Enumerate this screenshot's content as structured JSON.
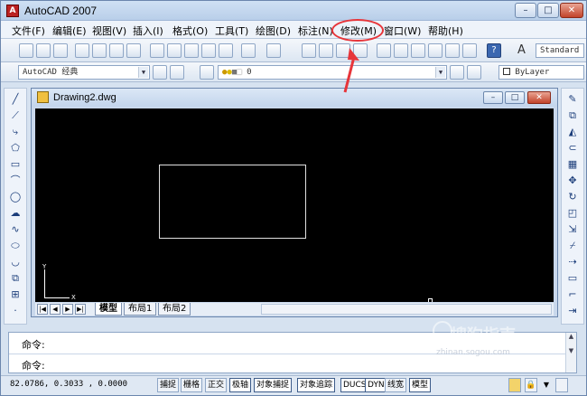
{
  "app": {
    "title": "AutoCAD 2007"
  },
  "window_buttons": {
    "minimize": "–",
    "maximize": "□",
    "close": "✕"
  },
  "menu": [
    {
      "label": "文件(F)"
    },
    {
      "label": "编辑(E)"
    },
    {
      "label": "视图(V)"
    },
    {
      "label": "插入(I)"
    },
    {
      "label": "格式(O)"
    },
    {
      "label": "工具(T)"
    },
    {
      "label": "绘图(D)"
    },
    {
      "label": "标注(N)"
    },
    {
      "label": "修改(M)"
    },
    {
      "label": "窗口(W)"
    },
    {
      "label": "帮助(H)"
    }
  ],
  "toolbar": {
    "text_style": "Standard",
    "workspace": "AutoCAD 经典",
    "layer": "0",
    "color": "ByLayer"
  },
  "document": {
    "title": "Drawing2.dwg"
  },
  "ucs": {
    "x_label": "X",
    "y_label": "Y"
  },
  "layout_tabs": [
    {
      "label": "模型",
      "active": true
    },
    {
      "label": "布局1",
      "active": false
    },
    {
      "label": "布局2",
      "active": false
    }
  ],
  "command": {
    "line1": "命令:",
    "line2": "命令:"
  },
  "status": {
    "coordinates": "82.0786, 0.3033 , 0.0000",
    "buttons": [
      {
        "label": "捕捉",
        "on": false
      },
      {
        "label": "栅格",
        "on": false
      },
      {
        "label": "正交",
        "on": false
      },
      {
        "label": "极轴",
        "on": true
      },
      {
        "label": "对象捕捉",
        "on": true
      },
      {
        "label": "对象追踪",
        "on": true
      },
      {
        "label": "DUCS",
        "on": true
      },
      {
        "label": "DYN",
        "on": true
      },
      {
        "label": "线宽",
        "on": false
      },
      {
        "label": "模型",
        "on": true
      }
    ]
  },
  "annotation": {
    "highlight_color": "#e7353a"
  },
  "watermark": {
    "text": "搜狗指南",
    "subtext": "zhinan.sogou.com"
  }
}
